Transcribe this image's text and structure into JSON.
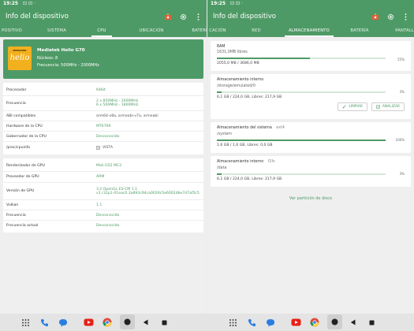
{
  "left": {
    "status_time": "19:25",
    "status_icons": "⊡ ⊡ ·",
    "app_title": "Info del dispositivo",
    "tabs": [
      "POSITIVO",
      "SISTEMA",
      "CPU",
      "UBICACIÓN",
      "BATERÍA"
    ],
    "active_tab": "CPU",
    "header": {
      "brand": "MEDIATEK",
      "logo_text": "helio",
      "chip_name": "Mediatek Helio G70",
      "cores": "Núcleos: 8",
      "frequency": "Frecuencia: 500MHz - 2000MHz"
    },
    "cpu_rows": [
      {
        "k": "Procesador",
        "v": [
          "64bit"
        ]
      },
      {
        "k": "Frecuencia",
        "v": [
          "2 x 850MHz - 2000MHz",
          "6 x 500MHz - 1800MHz"
        ]
      },
      {
        "k": "ABI compatibles",
        "v": [
          "arm64-v8a, armeabi-v7a, armeabi"
        ],
        "muted": true
      },
      {
        "k": "Hardware de la CPU",
        "v": [
          "MT6769"
        ]
      },
      {
        "k": "Gobernador de la CPU",
        "v": [
          "Desconocido"
        ]
      },
      {
        "k": "/proc/cpuinfo",
        "v": [
          "VISTA"
        ],
        "muted": true,
        "icon": true
      }
    ],
    "gpu_rows": [
      {
        "k": "Renderizador de GPU",
        "v": [
          "Mali-G52 MC2"
        ]
      },
      {
        "k": "Proveedor de GPU",
        "v": [
          "ARM"
        ]
      },
      {
        "k": "Versión de GPU",
        "v": [
          "3.2 OpenGL ES-CM 1.1",
          "v1.r32p1-01eac0.3a893c94ca0026c5e6002dbe7d7af5c5"
        ]
      },
      {
        "k": "Vulkan",
        "v": [
          "1.1"
        ]
      },
      {
        "k": "Frecuencia",
        "v": [
          "Desconocido"
        ]
      },
      {
        "k": "Frecuencia actual",
        "v": [
          "Desconocido"
        ]
      }
    ]
  },
  "right": {
    "status_time": "19:25",
    "status_icons": "⊡ ⊡ ·",
    "app_title": "Info del dispositivo",
    "tabs": [
      "CACIÓN",
      "RED",
      "ALMACENAMIENTO",
      "BATERÍA",
      "PANTALLA"
    ],
    "active_tab": "ALMACENAMIENTO",
    "ram": {
      "title": "RAM",
      "free": "1631,0MB libres",
      "percent_text": "55%",
      "fraction": 0.55,
      "foot": "2055,0 MB / 3686,0 MB"
    },
    "internal": {
      "title": "Almacenamiento interno",
      "path": "/storage/emulated/0",
      "percent_text": "3%",
      "fraction": 0.03,
      "foot": "6,1 GB / 224,0 GB, Libres: 217,9 GB",
      "btn_clean": "LIMPIAR",
      "btn_analyze": "ANALIZAR"
    },
    "system": {
      "title": "Almacenamiento del sistema",
      "fs": "ext4",
      "path": "/system",
      "percent_text": "100%",
      "fraction": 1.0,
      "foot": "1,6 GB / 1,6 GB, Libres: 0,0 GB"
    },
    "data": {
      "title": "Almacenamiento interno",
      "fs": "f2fs",
      "path": "/data",
      "percent_text": "3%",
      "fraction": 0.03,
      "foot": "6,1 GB / 224,0 GB, Libres: 217,9 GB"
    },
    "partition_link": "Ver partición de disco"
  },
  "accent_color": "#4e9a66"
}
